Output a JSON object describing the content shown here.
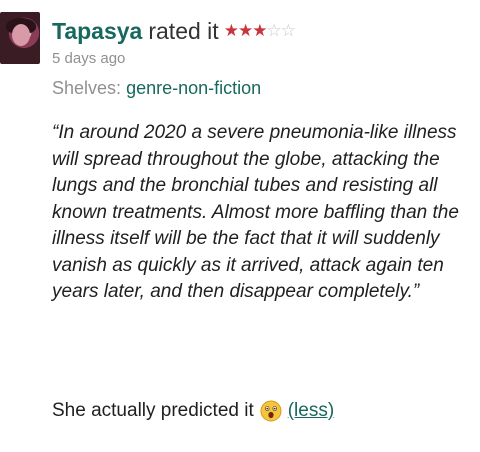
{
  "review": {
    "user_name": "Tapasya",
    "rated_text": "rated it",
    "rating": {
      "value": 3,
      "max": 5,
      "on_color": "#c8353c",
      "off_color": "#c8c8c8"
    },
    "time_ago": "5 days ago",
    "shelves_label": "Shelves:",
    "shelf": "genre-non-fiction",
    "quote": "“In around 2020 a severe pneumonia-like illness will spread throughout the globe, attacking the lungs and the bronchial tubes and resisting all known treatments. Almost more baffling than the illness itself will be the fact that it will suddenly vanish as quickly as it arrived, attack again ten years later, and then disappear completely.”",
    "comment": "She actually predicted it",
    "emoji_icon": "astonished-face-icon",
    "less_link": "(less)"
  },
  "colors": {
    "link_green": "#17685e",
    "muted_gray": "#909090"
  }
}
